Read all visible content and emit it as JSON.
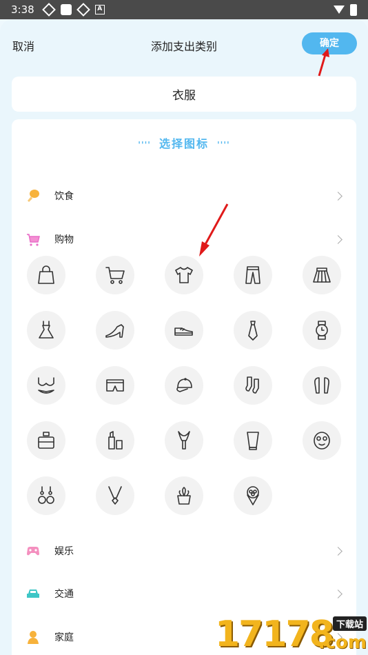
{
  "status_bar": {
    "time": "3:38"
  },
  "header": {
    "cancel_label": "取消",
    "title": "添加支出类别",
    "confirm_label": "确定"
  },
  "name_input": {
    "value": "衣服"
  },
  "icon_section": {
    "title": "选择图标",
    "categories_top": [
      {
        "label": "饮食",
        "icon": "drumstick-icon",
        "color": "#f5a623"
      },
      {
        "label": "购物",
        "icon": "shopping-cart-icon",
        "color": "#e86fc8"
      }
    ],
    "shopping_icons": [
      "handbag-icon",
      "cart-icon",
      "tshirt-icon",
      "pants-icon",
      "skirt-icon",
      "dress-icon",
      "high-heel-icon",
      "sneaker-icon",
      "tie-icon",
      "watch-icon",
      "bra-icon",
      "underwear-icon",
      "cap-icon",
      "socks-icon",
      "earbuds-icon",
      "perfume-icon",
      "lipstick-icon",
      "makeup-brush-icon",
      "lotion-icon",
      "face-mask-icon",
      "earrings-icon",
      "necklace-icon",
      "plant-pot-icon",
      "flower-bouquet-icon"
    ],
    "categories_bottom": [
      {
        "label": "娱乐",
        "icon": "gamepad-icon",
        "color": "#f06fa8"
      },
      {
        "label": "交通",
        "icon": "car-icon",
        "color": "#3ec6c6"
      },
      {
        "label": "家庭",
        "icon": "family-icon",
        "color": "#f5a623"
      }
    ]
  },
  "watermark": {
    "digits": "17178",
    "top_text": "下载站",
    "suffix": ".com"
  }
}
